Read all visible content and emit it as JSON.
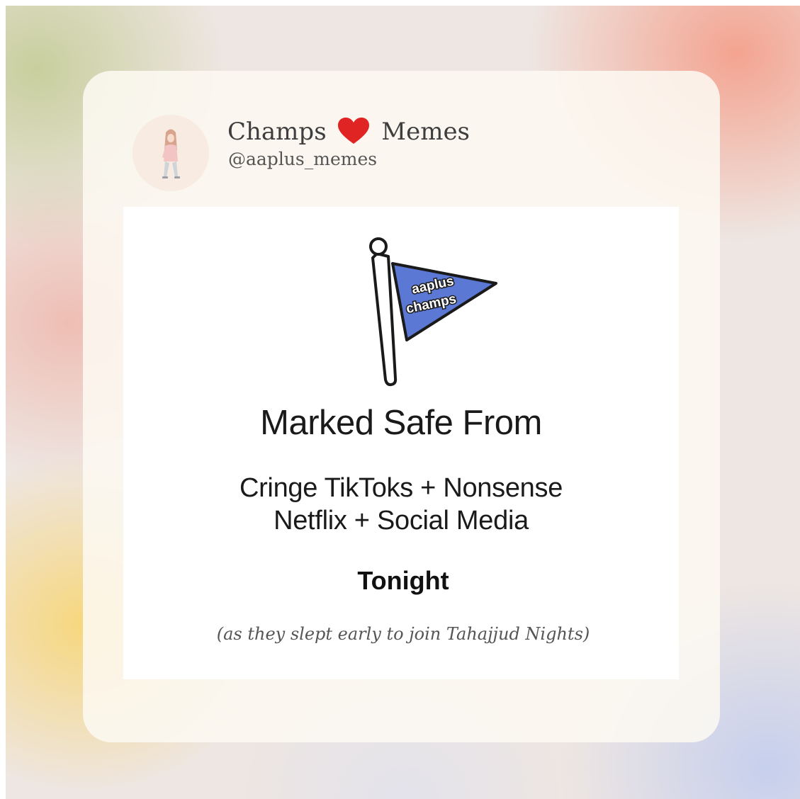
{
  "profile": {
    "name_part1": "Champs",
    "name_part2": "Memes",
    "heart_icon": "heart-icon",
    "heart_color": "#e02424",
    "handle": "@aaplus_memes",
    "avatar_icon": "girl-illustration-icon"
  },
  "post": {
    "flag": {
      "icon": "flag-icon",
      "label_line1": "aaplus",
      "label_line2": "champs",
      "color": "#5b78d4"
    },
    "headline": "Marked Safe From",
    "line1": "Cringe TikToks + Nonsense",
    "line2": "Netflix + Social Media",
    "tonight": "Tonight",
    "caption": "(as they slept early to join Tahajjud Nights)"
  },
  "colors": {
    "card_background": "#fcf8f1",
    "text": "#1a1a1a",
    "flag_blue": "#5b78d4",
    "heart_red": "#e02424"
  }
}
